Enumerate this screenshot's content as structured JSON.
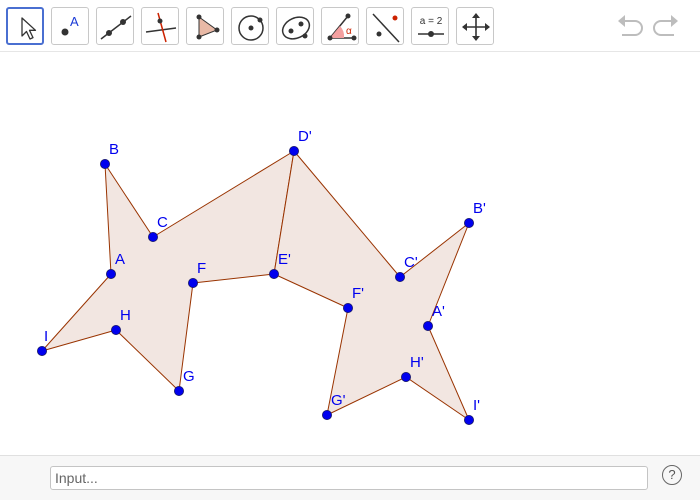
{
  "toolbar": {
    "tools": [
      {
        "name": "move",
        "label": ""
      },
      {
        "name": "point",
        "label": "A"
      },
      {
        "name": "line",
        "label": ""
      },
      {
        "name": "perpendicular-line",
        "label": ""
      },
      {
        "name": "polygon",
        "label": ""
      },
      {
        "name": "circle",
        "label": ""
      },
      {
        "name": "ellipse",
        "label": ""
      },
      {
        "name": "angle",
        "label": "α"
      },
      {
        "name": "reflect",
        "label": ""
      },
      {
        "name": "slider",
        "label": "a = 2"
      },
      {
        "name": "move-graphics-view",
        "label": ""
      }
    ],
    "active_tool": "move",
    "undo_icon": "undo-icon",
    "redo_icon": "redo-icon"
  },
  "graphics": {
    "polygon_fill": "#f2e6e1",
    "polygon_stroke": "#993300",
    "point_color": "#0000ee",
    "points": [
      {
        "label": "B"
      },
      {
        "label": "C"
      },
      {
        "label": "D'"
      },
      {
        "label": "A"
      },
      {
        "label": "F"
      },
      {
        "label": "E'"
      },
      {
        "label": "H"
      },
      {
        "label": "I"
      },
      {
        "label": "G"
      },
      {
        "label": "B'"
      },
      {
        "label": "C'"
      },
      {
        "label": "F'"
      },
      {
        "label": "A'"
      },
      {
        "label": "H'"
      },
      {
        "label": "G'"
      },
      {
        "label": "I'"
      }
    ]
  },
  "input_bar": {
    "placeholder": "Input...",
    "value": "",
    "help_label": "?"
  }
}
